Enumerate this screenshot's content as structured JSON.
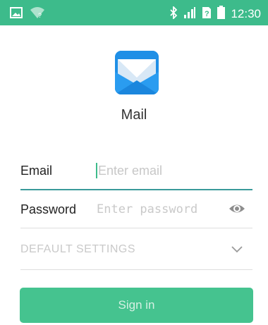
{
  "status_bar": {
    "time": "12:30",
    "icons": [
      "image-icon",
      "wifi-question-icon",
      "bluetooth-icon",
      "signal-icon",
      "sim-icon",
      "battery-icon"
    ]
  },
  "app": {
    "name": "Mail",
    "icon": "mail-envelope-icon"
  },
  "form": {
    "email_label": "Email",
    "email_placeholder": "Enter email",
    "password_label": "Password",
    "password_placeholder": "Enter password",
    "settings_label": "DEFAULT SETTINGS",
    "signin_label": "Sign in"
  },
  "colors": {
    "accent": "#3dbb8b",
    "button": "#45c38f",
    "mail_blue": "#1f8fe6"
  }
}
